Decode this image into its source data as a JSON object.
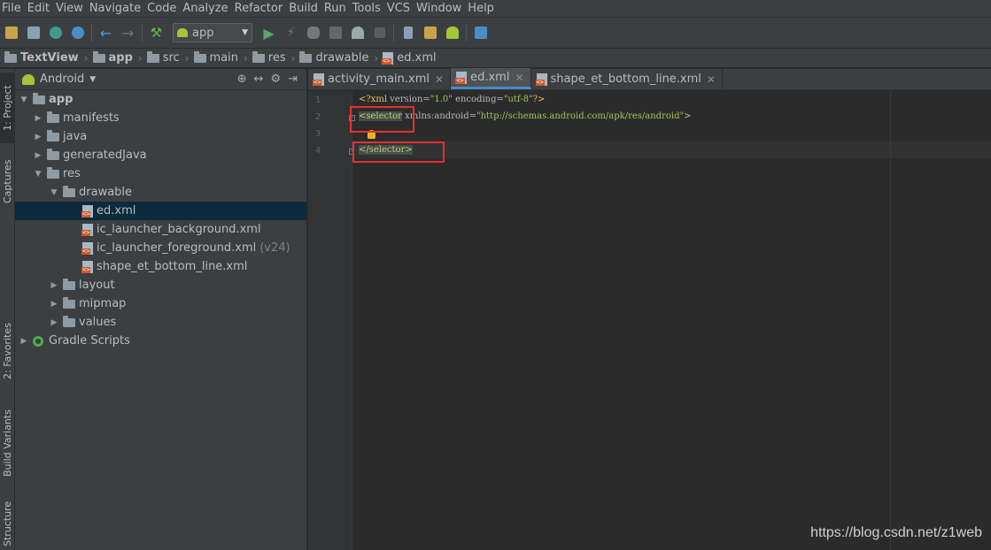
{
  "menu": [
    "File",
    "Edit",
    "View",
    "Navigate",
    "Code",
    "Analyze",
    "Refactor",
    "Build",
    "Run",
    "Tools",
    "VCS",
    "Window",
    "Help"
  ],
  "toolbar": {
    "run_config": "app",
    "icons": [
      "open-folder-icon",
      "save-icon",
      "sync-icon",
      "refresh-icon",
      "back-icon",
      "forward-icon",
      "build-hammer-icon",
      "run-icon",
      "apply-changes-icon",
      "debug-icon",
      "attach-debugger-icon",
      "profile-icon",
      "stop-icon",
      "avd-manager-icon",
      "sdk-manager-icon",
      "android-device-icon",
      "layout-inspector-icon"
    ]
  },
  "breadcrumbs": [
    "TextView",
    "app",
    "src",
    "main",
    "res",
    "drawable",
    "ed.xml"
  ],
  "side_stripe": {
    "project": "1: Project",
    "captures": "Captures",
    "favorites": "2: Favorites",
    "build_variants": "Build Variants",
    "structure": "Structure"
  },
  "project_panel": {
    "view_mode": "Android",
    "tree": [
      {
        "label": "app",
        "level": 0,
        "expanded": true,
        "kind": "module"
      },
      {
        "label": "manifests",
        "level": 1,
        "expanded": false,
        "kind": "folder"
      },
      {
        "label": "java",
        "level": 1,
        "expanded": false,
        "kind": "folder"
      },
      {
        "label": "generatedJava",
        "level": 1,
        "expanded": false,
        "kind": "folder"
      },
      {
        "label": "res",
        "level": 1,
        "expanded": true,
        "kind": "folder"
      },
      {
        "label": "drawable",
        "level": 2,
        "expanded": true,
        "kind": "folder"
      },
      {
        "label": "ed.xml",
        "level": 3,
        "kind": "xml",
        "selected": true
      },
      {
        "label": "ic_launcher_background.xml",
        "level": 3,
        "kind": "xml"
      },
      {
        "label": "ic_launcher_foreground.xml",
        "suffix": "(v24)",
        "level": 3,
        "kind": "xml"
      },
      {
        "label": "shape_et_bottom_line.xml",
        "level": 3,
        "kind": "xml"
      },
      {
        "label": "layout",
        "level": 2,
        "expanded": false,
        "kind": "folder"
      },
      {
        "label": "mipmap",
        "level": 2,
        "expanded": false,
        "kind": "folder"
      },
      {
        "label": "values",
        "level": 2,
        "expanded": false,
        "kind": "folder"
      },
      {
        "label": "Gradle Scripts",
        "level": 0,
        "expanded": false,
        "kind": "gradle"
      }
    ]
  },
  "editor": {
    "tabs": [
      {
        "label": "activity_main.xml",
        "active": false
      },
      {
        "label": "ed.xml",
        "active": true
      },
      {
        "label": "shape_et_bottom_line.xml",
        "active": false
      }
    ],
    "line_numbers": [
      "1",
      "2",
      "3",
      "4"
    ],
    "lines": {
      "l1": {
        "open": "<?xml ",
        "a1": "version=",
        "v1": "\"1.0\"",
        "a2": " encoding=",
        "v2": "\"utf-8\"",
        "close": "?>"
      },
      "l2": {
        "tag": "<selector",
        "attr": " xmlns:android=",
        "val": "\"http://schemas.android.com/apk/res/android\"",
        "close": ">"
      },
      "l4": {
        "tag": "</selector>"
      }
    }
  },
  "watermark": "https://blog.csdn.net/z1web"
}
